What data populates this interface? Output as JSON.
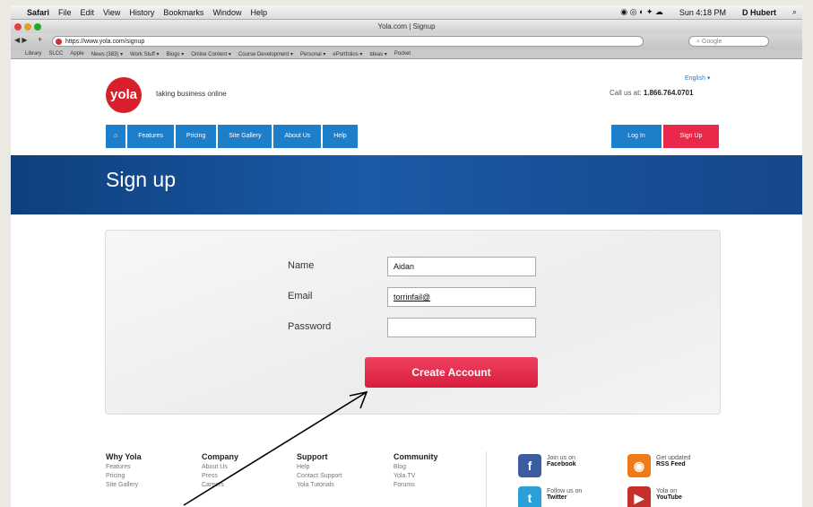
{
  "menubar": {
    "items": [
      "Safari",
      "File",
      "Edit",
      "View",
      "History",
      "Bookmarks",
      "Window",
      "Help"
    ],
    "clock": "Sun 4:18 PM",
    "user": "D Hubert"
  },
  "window": {
    "title": "Yola.com | Signup",
    "url": "https://www.yola.com/signup",
    "search_placeholder": "Google"
  },
  "bookmarks": [
    "Library",
    "SLCC",
    "Apple",
    "News (383) ▾",
    "Work Stuff ▾",
    "Blogs ▾",
    "Online Content ▾",
    "Course Development ▾",
    "Personal ▾",
    "ePortfolios ▾",
    "Ideas ▾",
    "Pocket"
  ],
  "site": {
    "logo": "yola",
    "tagline": "taking business online",
    "language": "English ▾",
    "call_label": "Call us at:",
    "phone": "1.866.764.0701"
  },
  "nav": {
    "items": [
      "Features",
      "Pricing",
      "Site Gallery",
      "About Us",
      "Help"
    ],
    "login": "Log In",
    "signup": "Sign Up"
  },
  "banner": {
    "title": "Sign up"
  },
  "form": {
    "name_label": "Name",
    "name_value": "Aidan",
    "email_label": "Email",
    "email_value": "torrinfail@",
    "password_label": "Password",
    "password_value": "",
    "submit": "Create Account"
  },
  "footer": {
    "columns": [
      {
        "title": "Why Yola",
        "links": [
          "Features",
          "Pricing",
          "Site Gallery"
        ]
      },
      {
        "title": "Company",
        "links": [
          "About Us",
          "Press",
          "Careers"
        ]
      },
      {
        "title": "Support",
        "links": [
          "Help",
          "Contact Support",
          "Yola Tutorials"
        ]
      },
      {
        "title": "Community",
        "links": [
          "Blog",
          "Yola.TV",
          "Forums"
        ]
      }
    ],
    "social": [
      {
        "line1": "Join us on",
        "line2": "Facebook",
        "color": "#3b5ca0",
        "icon": "facebook-icon",
        "glyph": "f"
      },
      {
        "line1": "Get updated",
        "line2": "RSS Feed",
        "color": "#f07a1a",
        "icon": "rss-icon",
        "glyph": "◉"
      },
      {
        "line1": "Follow us on",
        "line2": "Twitter",
        "color": "#2aa0d8",
        "icon": "twitter-icon",
        "glyph": "t"
      },
      {
        "line1": "Yola on",
        "line2": "YouTube",
        "color": "#c4302b",
        "icon": "youtube-icon",
        "glyph": "▶"
      }
    ]
  },
  "colors": {
    "brand_red": "#d8202c",
    "nav_blue": "#1d7ec9",
    "signup_pink": "#e8294a",
    "banner_blue": "#1a5aa6"
  }
}
